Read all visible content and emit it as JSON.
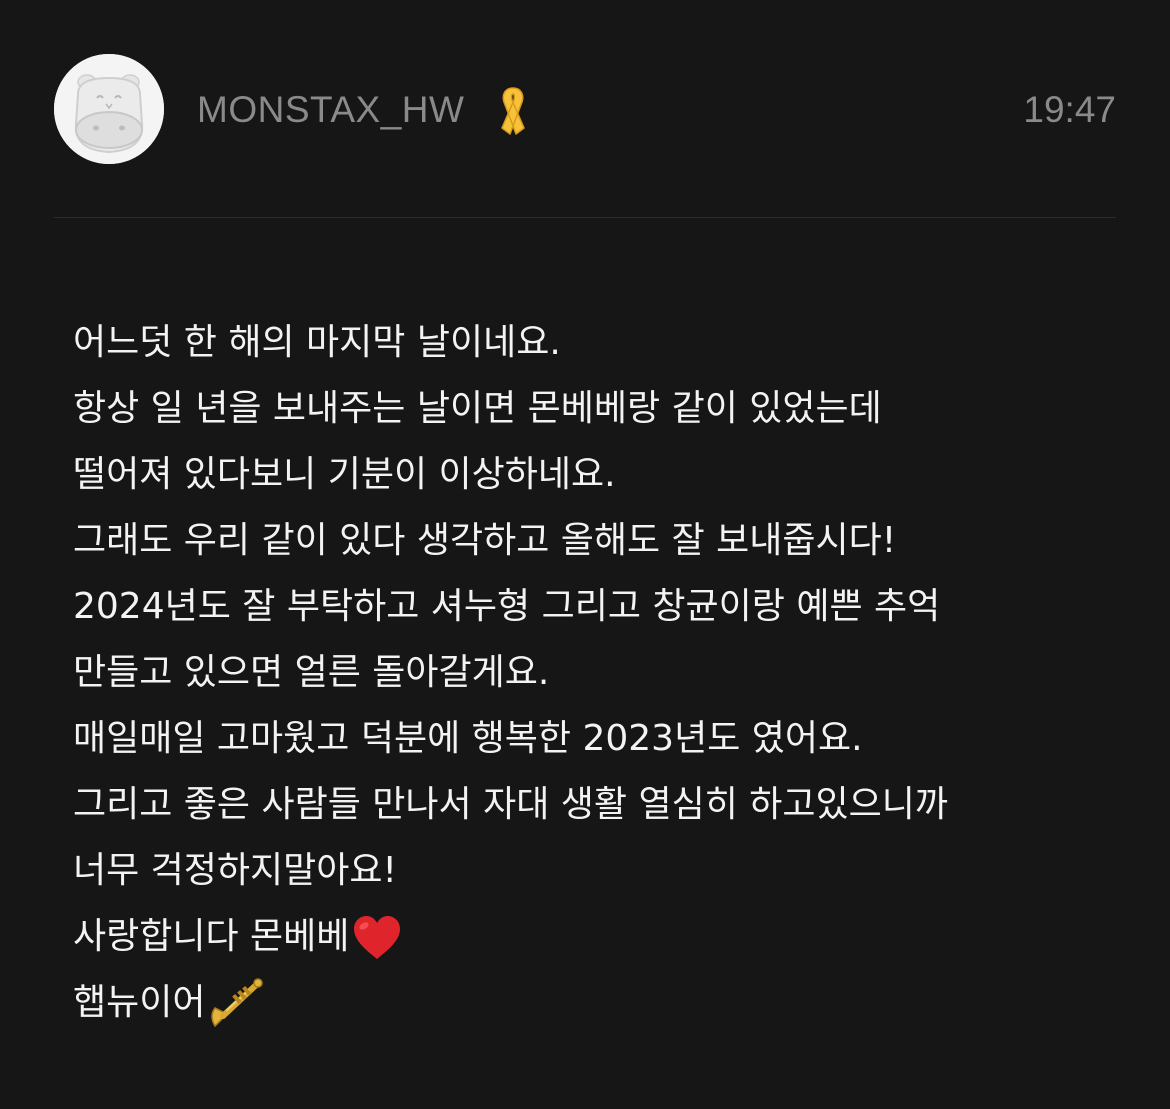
{
  "header": {
    "username": "MONSTAX_HW",
    "time": "19:47",
    "badge_icon": "yellow-ribbon-icon",
    "badge_color": "#f5c23a"
  },
  "message": {
    "lines": [
      "어느덧 한 해의 마지막 날이네요.",
      "항상 일 년을 보내주는 날이면 몬베베랑 같이 있었는데",
      "떨어져 있다보니 기분이 이상하네요.",
      "그래도 우리 같이 있다 생각하고 올해도 잘 보내줍시다!",
      "2024년도 잘 부탁하고 셔누형 그리고 창균이랑 예쁜 추억",
      "만들고 있으면 얼른 돌아갈게요.",
      "매일매일 고마웠고 덕분에 행복한 2023년도 였어요.",
      "그리고 좋은 사람들 만나서 자대 생활 열심히 하고있으니까",
      "너무 걱정하지말아요!",
      "사랑합니다 몬베베",
      "햅뉴이어"
    ],
    "heart_icon": "red-heart-icon",
    "trumpet_icon": "trumpet-icon",
    "heart_color": "#e0242b"
  }
}
